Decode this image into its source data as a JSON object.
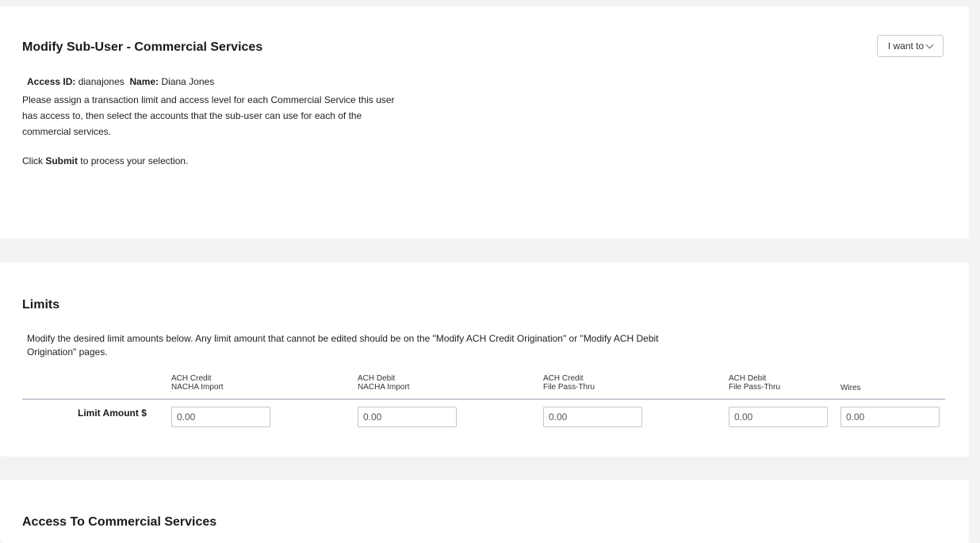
{
  "header": {
    "title": "Modify Sub-User - Commercial Services",
    "i_want_to": "I want to"
  },
  "user": {
    "access_id_label": "Access ID:",
    "access_id": "dianajones",
    "name_label": "Name:",
    "name": "Diana Jones"
  },
  "intro": {
    "description": "Please assign a transaction limit and access level for each Commercial Service this user has access to, then select the accounts that the sub-user can use for each of the commercial services.",
    "click_prefix": "Click",
    "click_bold": "Submit",
    "click_suffix": "to process your selection."
  },
  "limits": {
    "title": "Limits",
    "description": "Modify the desired limit amounts below. Any limit amount that cannot be edited should be on the \"Modify ACH Credit Origination\" or \"Modify ACH Debit Origination\" pages.",
    "row_label": "Limit Amount $",
    "columns": [
      {
        "line1": "ACH Credit",
        "line2": "NACHA Import",
        "value": "0.00"
      },
      {
        "line1": "ACH Debit",
        "line2": "NACHA Import",
        "value": "0.00"
      },
      {
        "line1": "ACH Credit",
        "line2": "File Pass-Thru",
        "value": "0.00"
      },
      {
        "line1": "ACH Debit",
        "line2": "File Pass-Thru",
        "value": "0.00"
      },
      {
        "line1": "Wires",
        "line2": "",
        "value": "0.00"
      }
    ]
  },
  "access": {
    "title": "Access To Commercial Services"
  }
}
